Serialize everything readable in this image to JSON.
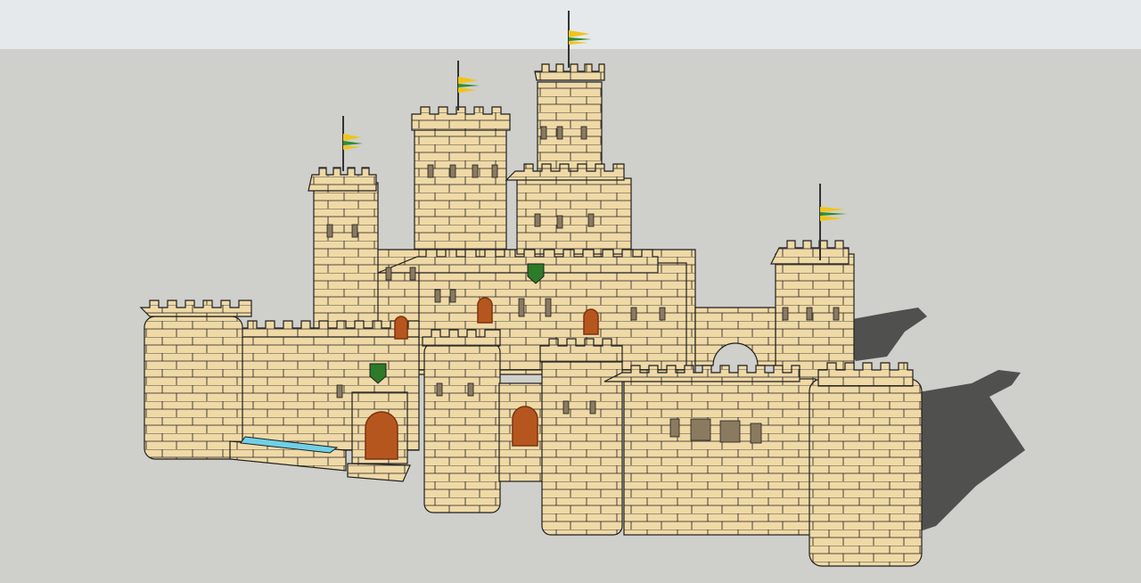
{
  "viewport": {
    "sky_color": "#e6e9ec",
    "sky_top_color": "#f2f3f5",
    "ground_color": "#cfcfcb",
    "shadow_color": "#3a3a3a"
  },
  "model": {
    "stone_color": "#efd9a6",
    "stone_shade_color": "#e3c98f",
    "outline_color": "#1f1f1f",
    "door_color": "#b6561f",
    "door_dark_color": "#7a3310",
    "shield_color": "#2c7a2a",
    "water_color": "#6fd0e6",
    "flag_colors": [
      "#f0c419",
      "#2f8c2f",
      "#f0c419"
    ],
    "window_color": "#8a7a60"
  }
}
